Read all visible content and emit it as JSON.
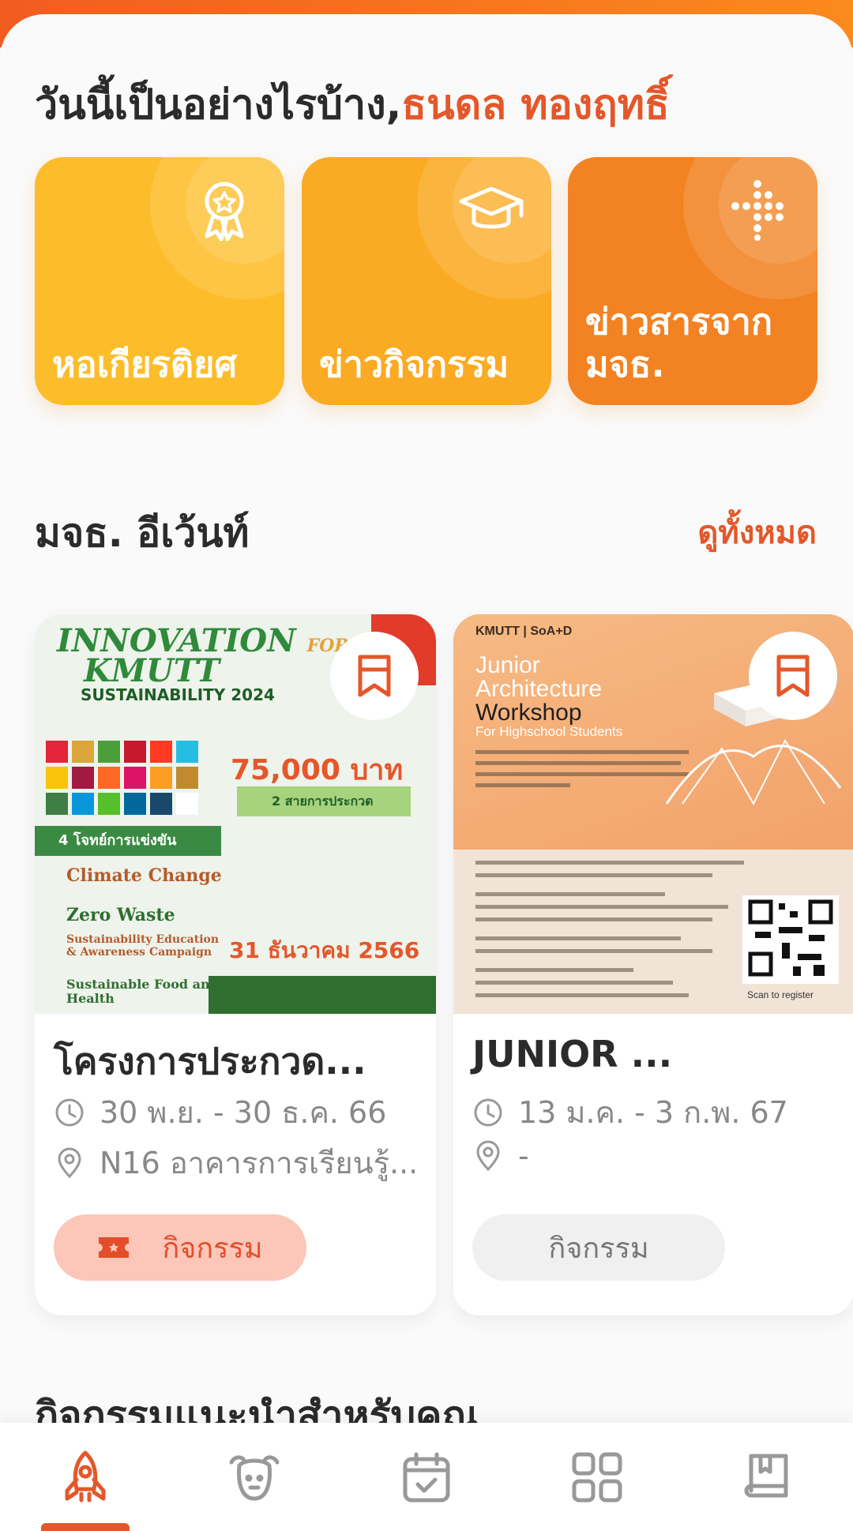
{
  "header": {
    "greeting": "วันนี้เป็นอย่างไรบ้าง,",
    "user_name": "ธนดล ทองฤทธิ์"
  },
  "quick_tiles": [
    {
      "label": "หอเกียรติยศ",
      "icon": "award-ribbon-icon",
      "color": "#fdbd2a"
    },
    {
      "label": "ข่าวกิจกรรม",
      "icon": "graduation-cap-icon",
      "color": "#fbaa23"
    },
    {
      "label": "ข่าวสารจาก มจธ.",
      "icon": "dots-cross-icon",
      "color": "#f28222"
    }
  ],
  "events_section": {
    "title": "มจธ. อีเว้นท์",
    "see_all": "ดูทั้งหมด"
  },
  "events": [
    {
      "title": "โครงการประกวด...",
      "date": "30 พ.ย. - 30 ธ.ค. 66",
      "location": "N16 อาคารการเรียนรู้...",
      "tag": "กิจกรรม",
      "poster": {
        "line1": "INNOVATION",
        "line1b": "FOR",
        "line2": "KMUTT",
        "line3": "SUSTAINABILITY 2024",
        "prize": "75,000 บาท",
        "tracks": "2 สายการประกวด",
        "challenges": "4 โจทย์การแข่งขัน",
        "topic1": "Climate Change",
        "topic2": "Zero Waste",
        "topic3": "Sustainability Education & Awareness Campaign",
        "topic4": "Sustainable Food and Health",
        "deadline": "31 ธันวาคม 2566"
      }
    },
    {
      "title": "JUNIOR ...",
      "date": "13 ม.ค. - 3 ก.พ. 67",
      "location": "-",
      "tag": "กิจกรรม",
      "poster": {
        "brand": "KMUTT | SoA+D",
        "line1": "Junior",
        "line2": "Architecture",
        "line3": "Workshop",
        "sub": "For Highschool Students",
        "scan": "Scan to register"
      }
    }
  ],
  "recommend_section": {
    "title": "กิจกรรมแนะนำสำหรับคุณ"
  },
  "bottom_nav": [
    {
      "name": "home",
      "icon": "rocket-icon",
      "active": true
    },
    {
      "name": "mascot",
      "icon": "dog-face-icon",
      "active": false
    },
    {
      "name": "calendar",
      "icon": "calendar-check-icon",
      "active": false
    },
    {
      "name": "apps",
      "icon": "grid-icon",
      "active": false
    },
    {
      "name": "book",
      "icon": "book-icon",
      "active": false
    }
  ],
  "colors": {
    "accent": "#e4572a",
    "tag_active_bg": "#fcc6b8",
    "tag_inactive_bg": "#f0f0f0"
  }
}
